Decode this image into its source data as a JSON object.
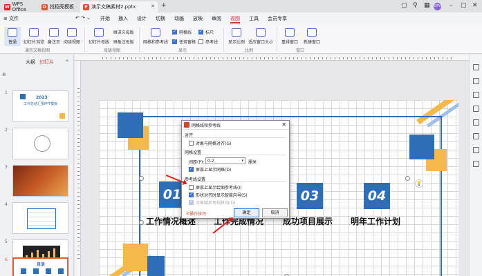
{
  "titlebar": {
    "tabs": [
      {
        "label": "WPS Office"
      },
      {
        "label": "找稻壳模板"
      },
      {
        "label": "演示文稿素材2.pptx"
      }
    ],
    "new_tab": "+",
    "avatar_text": "GPV"
  },
  "menu": {
    "file": "≡ 文件",
    "items": [
      "开始",
      "插入",
      "设计",
      "切换",
      "动画",
      "放映",
      "审阅",
      "视图",
      "工具",
      "会员专享"
    ],
    "active": "视图"
  },
  "ribbon": {
    "views": [
      "普通",
      "幻灯片浏览",
      "备注页",
      "阅读视图"
    ],
    "views_group": "演示文稿视图",
    "masters": [
      "幻灯片母版",
      "讲义母版",
      "备注母版"
    ],
    "masters_group": "母版视图",
    "show": {
      "gridlines": "网格线",
      "ruler": "标尺",
      "tasks": "任务窗格",
      "grid_guides": "网格和参考线",
      "guides": "参考线"
    },
    "show_group": "显示",
    "zoom": [
      "显示比例",
      "适应窗口大小"
    ],
    "zoom_group": "比例",
    "window": [
      "重排窗口",
      "新建窗口"
    ],
    "window_group": "窗口"
  },
  "leftpanel": {
    "tab_outline": "大纲",
    "tab_slides": "幻灯片",
    "slide_numbers": [
      "1",
      "2",
      "3",
      "4",
      "5",
      "6"
    ],
    "thumb1_title": "2023",
    "thumb1_sub": "工作总结汇报PPT模板",
    "thumb6_title": "目录"
  },
  "slide": {
    "numbers": [
      "01",
      "02",
      "03",
      "04"
    ],
    "captions": [
      "工作情况概述",
      "工作完成情况",
      "成功项目展示",
      "明年工作计划"
    ]
  },
  "dialog": {
    "title": "网格线和参考线",
    "sec_align": "对齐",
    "snap_to_grid": "对象与网格对齐(G)",
    "sec_grid": "网格设置",
    "spacing_label": "间距(P):",
    "spacing_value": "0.2",
    "spacing_unit": "厘米",
    "show_grid": "屏幕上显示网格(D)",
    "sec_guides": "参考线设置",
    "show_guides": "屏幕上显示绘图参考线(I)",
    "smart_guides": "形状对齐时显示智能向导(S)",
    "snap_guides": "对象随参考线移动(O)",
    "tips": "操作技巧",
    "ok": "确定",
    "cancel": "取消"
  },
  "colors": {
    "accent_blue": "#2d6fb7",
    "accent_orange": "#f5b84a",
    "wps_red": "#c7372c"
  }
}
